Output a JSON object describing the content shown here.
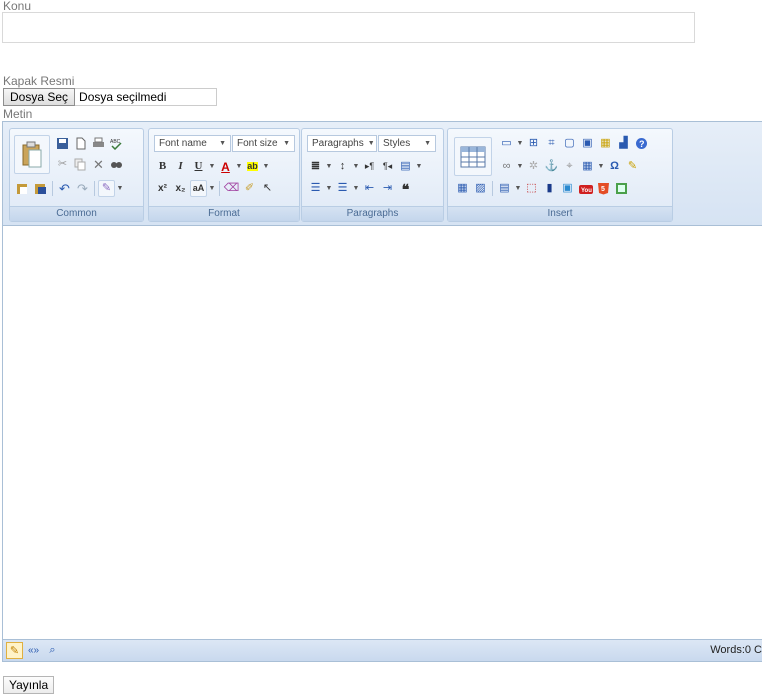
{
  "form": {
    "subject_label": "Konu",
    "subject_value": "",
    "cover_label": "Kapak Resmi",
    "file_button": "Dosya Seç",
    "file_status": "Dosya seçilmedi",
    "body_label": "Metin",
    "publish_button": "Yayınla"
  },
  "editor": {
    "groups": {
      "common": "Common",
      "format": "Format",
      "paragraphs": "Paragraphs",
      "insert": "Insert"
    },
    "font_name": "Font name",
    "font_size": "Font size",
    "paragraphs_combo": "Paragraphs",
    "styles_combo": "Styles",
    "bold": "B",
    "italic": "I",
    "underline": "U",
    "font_color": "A",
    "highlight": "ab",
    "omega": "Ω",
    "word_count": "Words:0 C",
    "colors": {
      "ribbon_top": "#e6eef8",
      "ribbon_bottom": "#d6e3f3",
      "border": "#a9bfd6",
      "group_label": "#4a6b94"
    }
  }
}
